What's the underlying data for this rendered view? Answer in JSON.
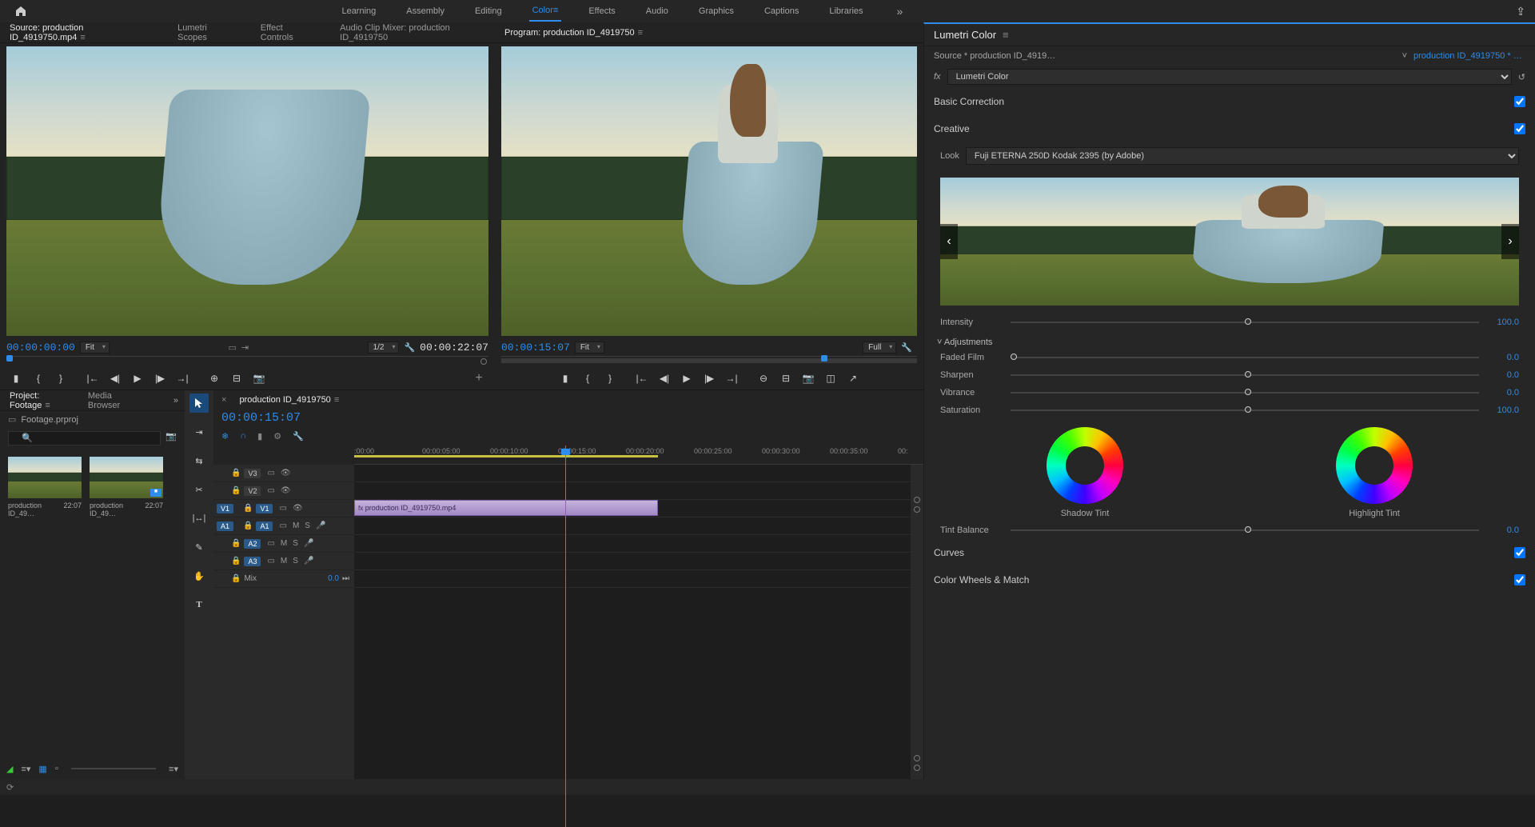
{
  "top_bar": {
    "workspaces": [
      "Learning",
      "Assembly",
      "Editing",
      "Color",
      "Effects",
      "Audio",
      "Graphics",
      "Captions",
      "Libraries"
    ],
    "active_workspace": "Color"
  },
  "source_panel": {
    "tabs": {
      "source": "Source: production ID_4919750.mp4",
      "lumetri_scopes": "Lumetri Scopes",
      "effect_controls": "Effect Controls",
      "audio_mixer": "Audio Clip Mixer: production ID_4919750"
    },
    "timecode_in": "00:00:00:00",
    "fit": "Fit",
    "scale": "1/2",
    "timecode_out": "00:00:22:07"
  },
  "program_panel": {
    "tab": "Program: production ID_4919750",
    "timecode_in": "00:00:15:07",
    "fit": "Fit",
    "quality": "Full",
    "timecode_out": ""
  },
  "lumetri": {
    "title": "Lumetri Color",
    "crumb_source": "Source * production ID_4919…",
    "crumb_clip": "production ID_4919750 * p…",
    "fx": "Lumetri Color",
    "basic_correction": "Basic Correction",
    "creative": "Creative",
    "look_label": "Look",
    "look_value": "Fuji ETERNA 250D Kodak 2395 (by Adobe)",
    "intensity": {
      "label": "Intensity",
      "value": "100.0",
      "pos": 50
    },
    "adjustments": "Adjustments",
    "sliders": [
      {
        "label": "Faded Film",
        "value": "0.0",
        "pos": 0
      },
      {
        "label": "Sharpen",
        "value": "0.0",
        "pos": 50
      },
      {
        "label": "Vibrance",
        "value": "0.0",
        "pos": 50
      },
      {
        "label": "Saturation",
        "value": "100.0",
        "pos": 50
      }
    ],
    "shadow_tint": "Shadow Tint",
    "highlight_tint": "Highlight Tint",
    "tint_balance": {
      "label": "Tint Balance",
      "value": "0.0",
      "pos": 50
    },
    "curves": "Curves",
    "color_wheels_match": "Color Wheels & Match"
  },
  "project": {
    "tabs": {
      "project": "Project: Footage",
      "media_browser": "Media Browser"
    },
    "proj_name": "Footage.prproj",
    "thumbs": [
      {
        "name": "production ID_49…",
        "dur": "22:07"
      },
      {
        "name": "production ID_49…",
        "dur": "22:07"
      }
    ]
  },
  "timeline": {
    "sequence_tab": "production ID_4919750",
    "playhead_time": "00:00:15:07",
    "ruler": [
      ":00:00",
      "00:00:05:00",
      "00:00:10:00",
      "00:00:15:00",
      "00:00:20:00",
      "00:00:25:00",
      "00:00:30:00",
      "00:00:35:00",
      "00:"
    ],
    "tracks": {
      "v3": "V3",
      "v2": "V2",
      "v1": "V1",
      "a1": "A1",
      "a2": "A2",
      "a3": "A3",
      "mix": "Mix",
      "mix_val": "0.0"
    },
    "clip_name": "production ID_4919750.mp4"
  }
}
